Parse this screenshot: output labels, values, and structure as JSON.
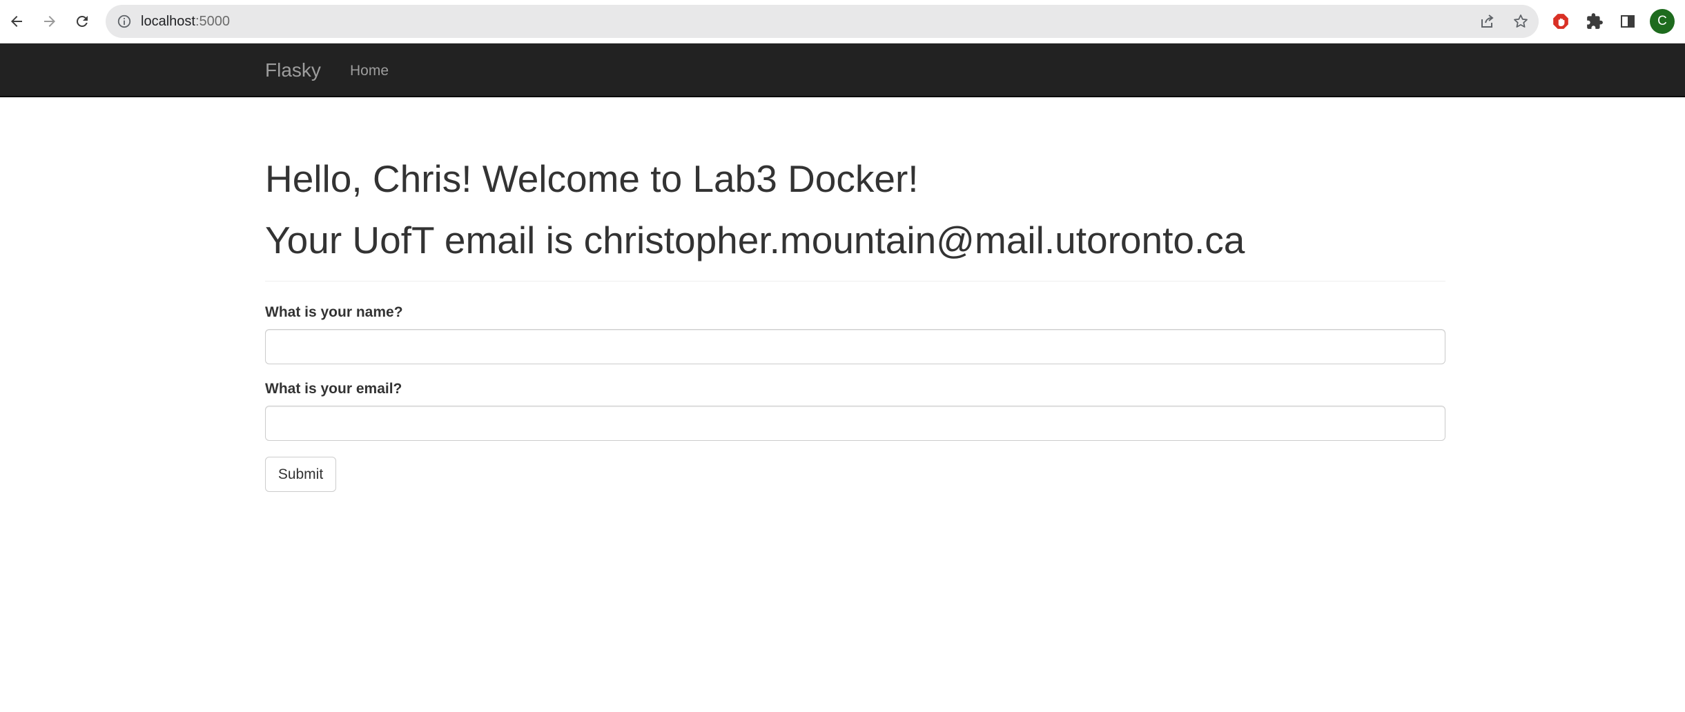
{
  "browser": {
    "url_host": "localhost",
    "url_port": ":5000",
    "profile_initial": "C"
  },
  "navbar": {
    "brand": "Flasky",
    "links": [
      {
        "label": "Home"
      }
    ]
  },
  "main": {
    "greeting": "Hello, Chris! Welcome to Lab3 Docker!",
    "email_line": "Your UofT email is christopher.mountain@mail.utoronto.ca"
  },
  "form": {
    "name_label": "What is your name?",
    "name_value": "",
    "email_label": "What is your email?",
    "email_value": "",
    "submit_label": "Submit"
  },
  "icons": {
    "back": "arrow-left-icon",
    "forward": "arrow-right-icon",
    "reload": "reload-icon",
    "site_info": "info-icon",
    "share": "share-icon",
    "bookmark": "star-icon",
    "adblock": "adblock-icon",
    "extensions": "puzzle-icon",
    "side_panel": "side-panel-icon"
  },
  "colors": {
    "navbar_bg": "#222222",
    "navbar_text": "#9d9d9d",
    "text": "#333333",
    "omnibox_bg": "#e8e8e9",
    "avatar_bg": "#1e6b1e",
    "adblock_red": "#d93025"
  }
}
